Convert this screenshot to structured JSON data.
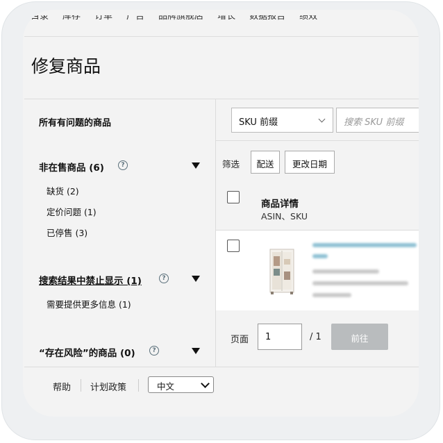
{
  "top_nav": {
    "items": [
      "目录",
      "库存",
      "订单",
      "广告",
      "品牌旗舰店",
      "增长",
      "数据报告",
      "绩效"
    ]
  },
  "page": {
    "title": "修复商品"
  },
  "sidebar": {
    "all_label": "所有有问题的商品",
    "sections": [
      {
        "title": "非在售商品 (6)",
        "items": [
          "缺货 (2)",
          "定价问题 (1)",
          "已停售 (3)"
        ]
      },
      {
        "title": "搜索结果中禁止显示 (1)",
        "items": [
          "需要提供更多信息 (1)"
        ]
      },
      {
        "title": "“存在风险”的商品 (0)",
        "items": []
      }
    ],
    "help_glyph": "?"
  },
  "main": {
    "sku_select": {
      "selected": "SKU 前缀"
    },
    "search": {
      "placeholder": "搜索 SKU 前缀"
    },
    "filter": {
      "label": "筛选",
      "buttons": [
        "配送",
        "更改日期"
      ]
    },
    "table": {
      "col_title": "商品详情",
      "col_sub": "ASIN、SKU"
    },
    "pagination": {
      "label": "页面",
      "current": "1",
      "total": "/ 1",
      "go_label": "前往"
    }
  },
  "footer": {
    "help": "帮助",
    "policy": "计划政策",
    "language": "中文"
  },
  "colors": {
    "frame": "#eef0f2",
    "card": "#f3f3f3",
    "go_button": "#b9bcbe",
    "blurred_link": "#8fc1d4"
  },
  "icons": [
    "help-circle-icon",
    "triangle-down-icon",
    "chevron-down-icon",
    "checkbox-icon",
    "wardrobe-product-image"
  ]
}
